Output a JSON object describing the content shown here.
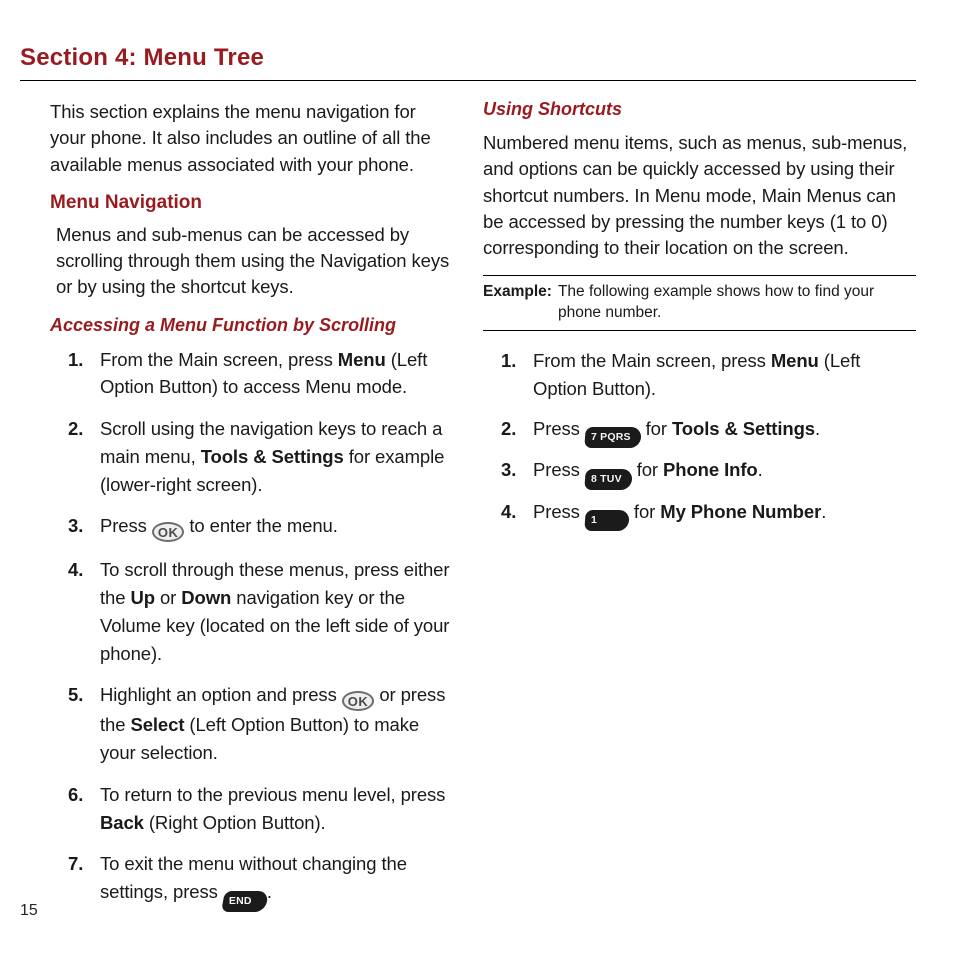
{
  "page_number": "15",
  "section_title": "Section 4: Menu Tree",
  "left": {
    "intro": "This section explains the menu navigation for your phone. It also includes an outline of all the available menus associated with your phone.",
    "h_menu_nav": "Menu Navigation",
    "menu_nav_p": "Menus and sub-menus can be accessed by scrolling through them using the Navigation keys or by using the shortcut keys.",
    "h_access": "Accessing a Menu Function by Scrolling",
    "s1a": "From the Main screen, press ",
    "s1b": "Menu",
    "s1c": " (Left Option Button) to access Menu mode.",
    "s2a": "Scroll using the navigation keys to reach a main menu, ",
    "s2b": "Tools & Settings",
    "s2c": " for example (lower-right screen).",
    "s3a": "Press ",
    "s3c": " to enter the menu.",
    "s4a": "To scroll through these menus, press either the ",
    "s4b": "Up",
    "s4c": " or ",
    "s4d": "Down",
    "s4e": " navigation key or the Volume key (located on the left side of your phone).",
    "s5a": "Highlight an option and press ",
    "s5c": " or press the ",
    "s5d": "Select",
    "s5e": " (Left Option Button) to make your selection.",
    "s6a": "To return to the previous menu level, press ",
    "s6b": "Back",
    "s6c": " (Right Option Button).",
    "s7a": "To exit the menu without changing the settings, press ",
    "s7c": "."
  },
  "right": {
    "h_shortcuts": "Using Shortcuts",
    "p_shortcuts": "Numbered menu items, such as menus, sub-menus, and options can be quickly accessed by using their shortcut numbers. In Menu mode, Main Menus can be accessed by pressing the number keys (1 to 0) corresponding to their location on the screen.",
    "example_label": "Example:",
    "example_text": "The following example shows how to find your phone number.",
    "r1a": "From the Main screen, press ",
    "r1b": "Menu",
    "r1c": " (Left Option Button).",
    "r2a": "Press ",
    "r2c": " for ",
    "r2d": "Tools & Settings",
    "r2e": ".",
    "r3a": "Press ",
    "r3c": " for ",
    "r3d": "Phone Info",
    "r3e": ".",
    "r4a": "Press ",
    "r4c": " for ",
    "r4d": "My Phone Number",
    "r4e": "."
  },
  "keys": {
    "ok": "OK",
    "end": "END",
    "k7": "7 PQRS",
    "k8": "8 TUV",
    "k1": "1"
  }
}
